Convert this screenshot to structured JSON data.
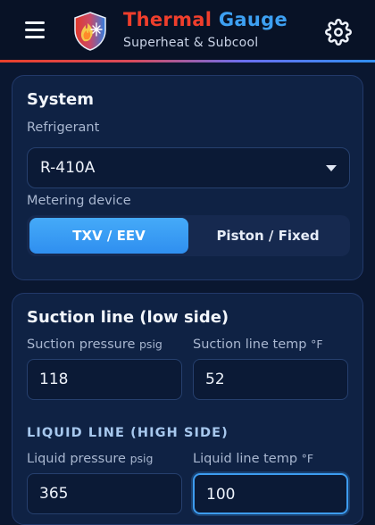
{
  "header": {
    "title_part1": "Thermal",
    "title_part2": "Gauge",
    "subtitle": "Superheat & Subcool",
    "menu_icon": "hamburger-menu-icon",
    "logo_icon": "shield-flame-snowflake-logo",
    "settings_icon": "gear-icon",
    "accent_red": "#ef3e2c",
    "accent_blue": "#3da0f2"
  },
  "system": {
    "title": "System",
    "refrigerant_label": "Refrigerant",
    "refrigerant_value": "R-410A",
    "metering_label": "Metering device",
    "metering_options": [
      "TXV / EEV",
      "Piston / Fixed"
    ],
    "metering_selected": "TXV / EEV"
  },
  "suction": {
    "title": "Suction line (low side)",
    "pressure_label": "Suction pressure",
    "pressure_unit": "psig",
    "pressure_value": "118",
    "temp_label": "Suction line temp",
    "temp_unit": "°F",
    "temp_value": "52"
  },
  "liquid": {
    "title": "LIQUID LINE (HIGH SIDE)",
    "pressure_label": "Liquid pressure",
    "pressure_unit": "psig",
    "pressure_value": "365",
    "temp_label": "Liquid line temp",
    "temp_unit": "°F",
    "temp_value": "100"
  }
}
